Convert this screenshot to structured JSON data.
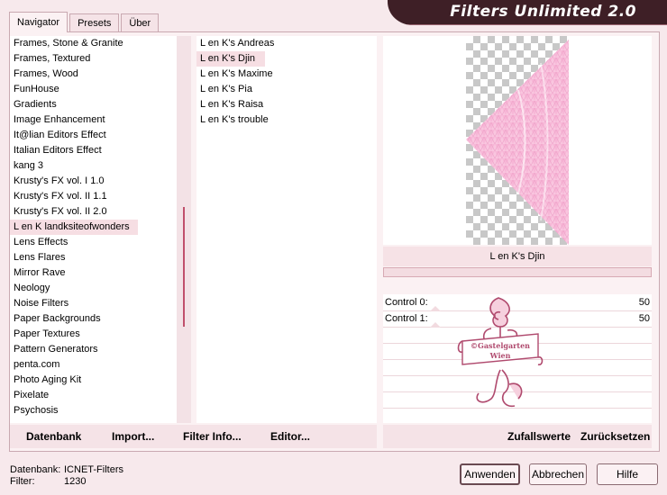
{
  "tabs": [
    "Navigator",
    "Presets",
    "Über"
  ],
  "title": "Filters Unlimited 2.0",
  "categories": [
    "Frames, Stone & Granite",
    "Frames, Textured",
    "Frames, Wood",
    "FunHouse",
    "Gradients",
    "Image Enhancement",
    "It@lian Editors Effect",
    "Italian Editors Effect",
    "kang 3",
    "Krusty's FX vol. I 1.0",
    "Krusty's FX vol. II 1.1",
    "Krusty's FX vol. II 2.0",
    "L en K landksiteofwonders",
    "Lens Effects",
    "Lens Flares",
    "Mirror Rave",
    "Neology",
    "Noise Filters",
    "Paper Backgrounds",
    "Paper Textures",
    "Pattern Generators",
    "penta.com",
    "Photo Aging Kit",
    "Pixelate",
    "Psychosis"
  ],
  "selected_category_index": 12,
  "filters": [
    "L en K's Andreas",
    "L en K's Djin",
    "L en K's Maxime",
    "L en K's Pia",
    "L en K's Raisa",
    "L en K's trouble"
  ],
  "selected_filter_index": 1,
  "preview": {
    "filter_name": "L en K's Djin",
    "accent_color": "#f6a9cf"
  },
  "controls": [
    {
      "label": "Control 0:",
      "value": "50"
    },
    {
      "label": "Control 1:",
      "value": "50"
    }
  ],
  "watermark": {
    "line1": "©Gastelgarten",
    "line2": "Wien"
  },
  "left_actions": {
    "database": "Datenbank",
    "import": "Import...",
    "filter_info": "Filter Info...",
    "editor": "Editor..."
  },
  "right_actions": {
    "random": "Zufallswerte",
    "reset": "Zurücksetzen"
  },
  "status": {
    "db_label": "Datenbank:",
    "db_value": "ICNET-Filters",
    "filter_label": "Filter:",
    "filter_value": "1230"
  },
  "buttons": {
    "apply": "Anwenden",
    "cancel": "Abbrechen",
    "help": "Hilfe"
  }
}
